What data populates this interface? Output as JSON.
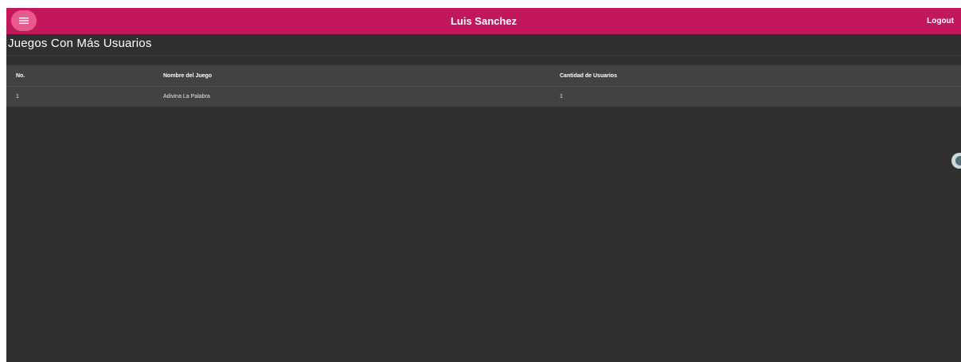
{
  "header": {
    "user_name": "Luis Sanchez",
    "logout_label": "Logout",
    "menu_icon": "hamburger-menu-icon"
  },
  "page": {
    "title": "Juegos Con Más Usuarios"
  },
  "table": {
    "columns": [
      "No.",
      "Nombre del Juego",
      "Cantidad de Usuarios"
    ],
    "rows": [
      [
        "1",
        "Adivina La Palabra",
        "1"
      ]
    ]
  },
  "colors": {
    "toolbar": "#c2185b",
    "menu_button": "#e85a8e",
    "background": "#303030",
    "table": "#424242"
  }
}
